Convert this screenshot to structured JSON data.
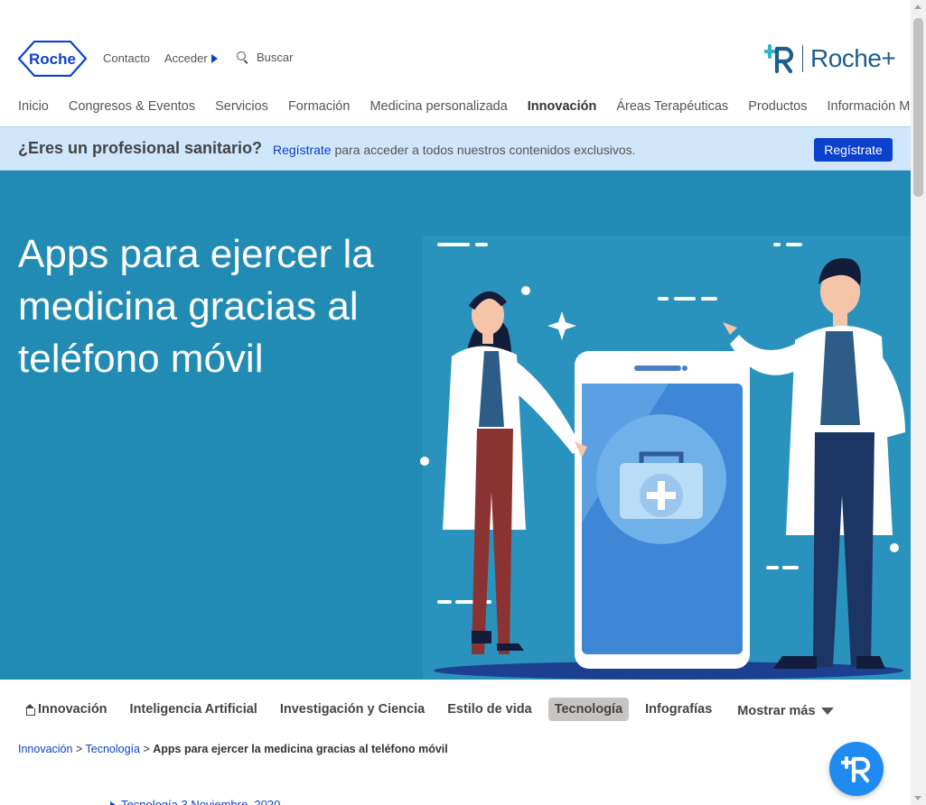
{
  "header": {
    "logo_text": "Roche",
    "contact_label": "Contacto",
    "login_label": "Acceder",
    "search_placeholder": "Buscar",
    "brand_plus_text": "Roche+"
  },
  "nav": {
    "items": [
      {
        "label": "Inicio"
      },
      {
        "label": "Congresos & Eventos"
      },
      {
        "label": "Servicios"
      },
      {
        "label": "Formación"
      },
      {
        "label": "Medicina personalizada"
      },
      {
        "label": "Innovación",
        "active": true
      },
      {
        "label": "Áreas Terapéuticas"
      },
      {
        "label": "Productos"
      },
      {
        "label": "Información Médica"
      }
    ]
  },
  "banner": {
    "question": "¿Eres un profesional sanitario?",
    "link_text": "Regístrate",
    "rest_text": " para acceder a todos nuestros contenidos exclusivos.",
    "button_label": "Regístrate"
  },
  "hero": {
    "title": "Apps para ejercer la medicina gracias al teléfono móvil"
  },
  "category_tabs": {
    "items": [
      {
        "label": "Innovación",
        "icon": "home-icon"
      },
      {
        "label": "Inteligencia Artificial"
      },
      {
        "label": "Investigación y Ciencia"
      },
      {
        "label": "Estilo de vida"
      },
      {
        "label": "Tecnología",
        "active": true
      },
      {
        "label": "Infografías"
      }
    ],
    "more_label": "Mostrar más"
  },
  "breadcrumb": {
    "items": [
      {
        "label": "Innovación"
      },
      {
        "label": "Tecnología"
      }
    ],
    "separator": " > ",
    "current": "Apps para ejercer la medicina gracias al teléfono móvil"
  },
  "article_meta": {
    "category": "Tecnología",
    "date": "3 Noviembre, 2020"
  },
  "colors": {
    "roche_blue": "#0b41cd",
    "hero_bg": "#228bb4",
    "banner_bg": "#d0e6fa",
    "fab_bg": "#1f8bf0",
    "active_tab_bg": "#c8c4c2"
  }
}
